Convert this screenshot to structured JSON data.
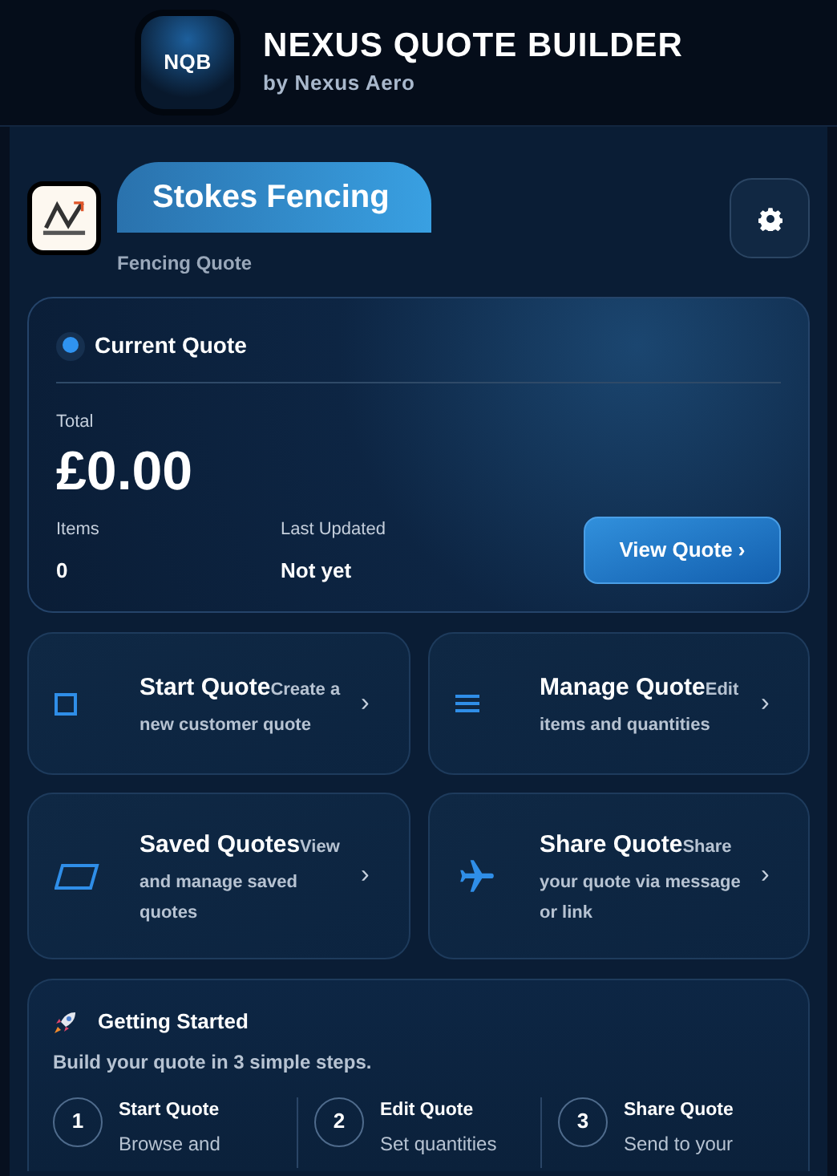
{
  "header": {
    "logo_text": "NQB",
    "title": "NEXUS QUOTE BUILDER",
    "subtitle": "by Nexus Aero"
  },
  "business": {
    "name": "Stokes Fencing",
    "subtitle": "Fencing Quote"
  },
  "current_quote": {
    "title": "Current Quote",
    "total_label": "Total",
    "total": "£0.00",
    "items_label": "Items",
    "items": "0",
    "updated_label": "Last Updated",
    "updated": "Not yet",
    "button": "View Quote ›"
  },
  "actions": [
    {
      "kind": "square",
      "title": "Start Quote",
      "description": "Create a new customer quote",
      "chevron": "›"
    },
    {
      "kind": "lines",
      "title": "Manage Quote",
      "description": "Edit items and quantities",
      "chevron": "›"
    },
    {
      "kind": "folder",
      "title": "Saved Quotes",
      "description": "View and manage saved quotes",
      "chevron": "›"
    },
    {
      "kind": "plane",
      "title": "Share Quote",
      "description": "Share your quote via message or link",
      "chevron": "›"
    }
  ],
  "getting_started": {
    "title": "Getting Started",
    "intro": "Build your quote in 3 simple steps.",
    "steps": [
      {
        "number": "1",
        "title": "Start Quote",
        "text": "Browse and"
      },
      {
        "number": "2",
        "title": "Edit Quote",
        "text": "Set quantities"
      },
      {
        "number": "3",
        "title": "Share Quote",
        "text": "Send to your"
      }
    ]
  }
}
